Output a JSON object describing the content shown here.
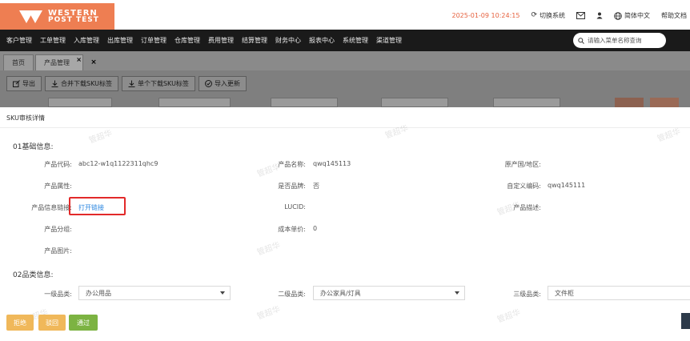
{
  "header": {
    "logo_line1": "WESTERN",
    "logo_line2": "POST TEST",
    "datetime": "2025-01-09 10:24:15",
    "switch_system": "切换系统",
    "language": "简体中文",
    "help": "帮助文档"
  },
  "menu": {
    "items": [
      "客户管理",
      "工单管理",
      "入库管理",
      "出库管理",
      "订单管理",
      "仓库管理",
      "费用管理",
      "结算管理",
      "财务中心",
      "报表中心",
      "系统管理",
      "渠道管理"
    ],
    "search_placeholder": "请输入菜单名称查询"
  },
  "tabs": {
    "home": "首页",
    "product": "产品管理",
    "product_close": "×",
    "close_all": "×"
  },
  "toolbar": {
    "export": "导出",
    "merge_download": "合并下载SKU标签",
    "single_download": "单个下载SKU标签",
    "import_update": "导入更新"
  },
  "dialog": {
    "title": "SKU审核详情",
    "basic_section": "01基础信息:",
    "category_section": "02品类信息:",
    "basic": {
      "product_code_label": "产品代码:",
      "product_code": "abc12-w1q1122311qhc9",
      "product_name_label": "产品名称:",
      "product_name": "qwq145113",
      "origin_label": "原产国/地区:",
      "origin": "",
      "attribute_label": "产品属性:",
      "attribute": "",
      "brand_label": "是否品牌:",
      "brand": "否",
      "custom_code_label": "自定义编码:",
      "custom_code": "qwq145111",
      "info_link_label": "产品信息链接:",
      "info_link": "打开链接",
      "lucid_label": "LUCID:",
      "lucid": "",
      "description_label": "产品描述:",
      "description": "",
      "group_label": "产品分组:",
      "group": "",
      "cost_label": "成本单价:",
      "cost": "0",
      "image_label": "产品图片:"
    },
    "category": {
      "level1_label": "一级品类:",
      "level1": "办公用品",
      "level2_label": "二级品类:",
      "level2": "办公家具/灯具",
      "level3_label": "三级品类:",
      "level3": "文件柜"
    },
    "watermark": "管超华",
    "buttons": {
      "reject": "拒绝",
      "return": "驳回",
      "approve": "通过"
    }
  },
  "colors": {
    "brand": "#ee7e52",
    "menu_bg": "#1a1a1a",
    "link": "#2a86e0",
    "highlight": "#e22a2a",
    "approve": "#7cb342",
    "reject": "#f0b85a"
  }
}
